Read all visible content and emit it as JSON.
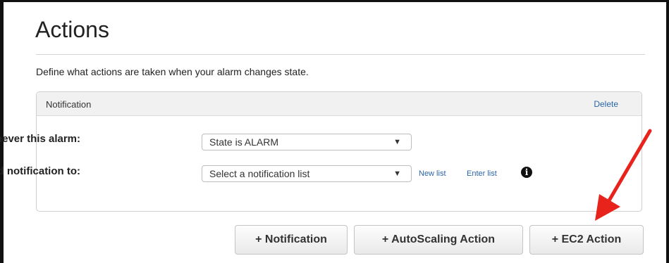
{
  "section": {
    "title": "Actions",
    "description": "Define what actions are taken when your alarm changes state."
  },
  "notification_panel": {
    "header": "Notification",
    "delete_label": "Delete",
    "alarm_row": {
      "label": "Whenever this alarm:",
      "selected": "State is ALARM"
    },
    "send_row": {
      "label": "Send notification to:",
      "selected": "Select a notification list",
      "new_list_label": "New list",
      "enter_list_label": "Enter list"
    }
  },
  "buttons": {
    "notification": "+ Notification",
    "autoscaling": "+ AutoScaling Action",
    "ec2": "+ EC2 Action"
  },
  "colors": {
    "link": "#2a64a8",
    "annotation_arrow": "#e8231b"
  },
  "icons": {
    "dropdown": "triangle-down",
    "info": "info-circle",
    "annotation": "red-arrow"
  }
}
